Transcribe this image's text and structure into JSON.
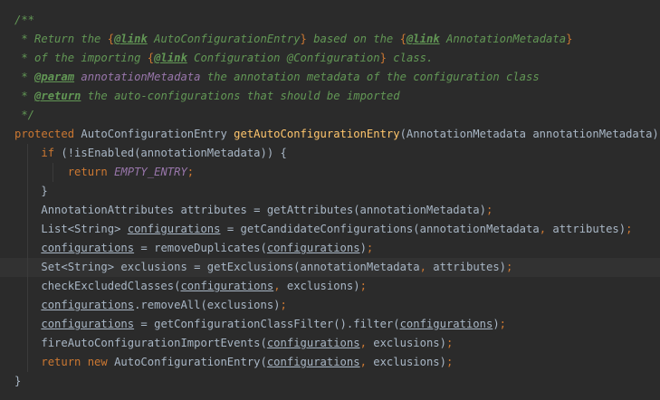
{
  "editor": {
    "language": "java",
    "theme_colors": {
      "background": "#2b2b2b",
      "current_line": "#323232",
      "comment": "#629755",
      "keyword": "#cc7832",
      "method": "#ffc66d",
      "constant": "#9876aa",
      "text": "#a9b7c6"
    },
    "lines": [
      {
        "indent": "",
        "segments": [
          {
            "t": "/**",
            "s": "c"
          }
        ]
      },
      {
        "indent": " ",
        "segments": [
          {
            "t": "* Return the ",
            "s": "c"
          },
          {
            "t": "{",
            "s": "br"
          },
          {
            "t": "@link",
            "s": "tag"
          },
          {
            "t": " AutoConfigurationEntry",
            "s": "lnk"
          },
          {
            "t": "}",
            "s": "br"
          },
          {
            "t": " based on the ",
            "s": "c"
          },
          {
            "t": "{",
            "s": "br"
          },
          {
            "t": "@link",
            "s": "tag"
          },
          {
            "t": " AnnotationMetadata",
            "s": "lnk"
          },
          {
            "t": "}",
            "s": "br"
          }
        ]
      },
      {
        "indent": " ",
        "segments": [
          {
            "t": "* of the importing ",
            "s": "c"
          },
          {
            "t": "{",
            "s": "br"
          },
          {
            "t": "@link",
            "s": "tag"
          },
          {
            "t": " Configuration ",
            "s": "lnk"
          },
          {
            "t": "@Configuration",
            "s": "lnk"
          },
          {
            "t": "}",
            "s": "br"
          },
          {
            "t": " class.",
            "s": "c"
          }
        ]
      },
      {
        "indent": " ",
        "segments": [
          {
            "t": "* ",
            "s": "c"
          },
          {
            "t": "@param",
            "s": "tag"
          },
          {
            "t": " annotationMetadata",
            "s": "cst"
          },
          {
            "t": " the annotation metadata of the configuration class",
            "s": "c"
          }
        ]
      },
      {
        "indent": " ",
        "segments": [
          {
            "t": "* ",
            "s": "c"
          },
          {
            "t": "@return",
            "s": "tag"
          },
          {
            "t": " the auto-configurations that should be imported",
            "s": "c"
          }
        ]
      },
      {
        "indent": " ",
        "segments": [
          {
            "t": "*/",
            "s": "c"
          }
        ]
      },
      {
        "indent": "",
        "segments": [
          {
            "t": "protected",
            "s": "k"
          },
          {
            "t": " AutoConfigurationEntry ",
            "s": ""
          },
          {
            "t": "getAutoConfigurationEntry",
            "s": "fn"
          },
          {
            "t": "(AnnotationMetadata annotationMetadata) {",
            "s": ""
          }
        ]
      },
      {
        "indent": "    ",
        "segments": [
          {
            "t": "if",
            "s": "k"
          },
          {
            "t": " (!isEnabled(annotationMetadata)) {",
            "s": ""
          }
        ]
      },
      {
        "indent": "        ",
        "segments": [
          {
            "t": "return",
            "s": "k"
          },
          {
            "t": " ",
            "s": ""
          },
          {
            "t": "EMPTY_ENTRY",
            "s": "cst"
          },
          {
            "t": ";",
            "s": "k"
          }
        ]
      },
      {
        "indent": "    ",
        "segments": [
          {
            "t": "}",
            "s": ""
          }
        ]
      },
      {
        "indent": "    ",
        "segments": [
          {
            "t": "AnnotationAttributes attributes = getAttributes(annotationMetadata)",
            "s": ""
          },
          {
            "t": ";",
            "s": "k"
          }
        ]
      },
      {
        "indent": "    ",
        "segments": [
          {
            "t": "List<String> ",
            "s": ""
          },
          {
            "t": "configurations",
            "s": "u"
          },
          {
            "t": " = getCandidateConfigurations(annotationMetadata",
            "s": ""
          },
          {
            "t": ",",
            "s": "k"
          },
          {
            "t": " attributes)",
            "s": ""
          },
          {
            "t": ";",
            "s": "k"
          }
        ]
      },
      {
        "indent": "    ",
        "segments": [
          {
            "t": "configurations",
            "s": "u"
          },
          {
            "t": " = removeDuplicates(",
            "s": ""
          },
          {
            "t": "configurations",
            "s": "u"
          },
          {
            "t": ")",
            "s": ""
          },
          {
            "t": ";",
            "s": "k"
          }
        ]
      },
      {
        "indent": "    ",
        "current": true,
        "segments": [
          {
            "t": "Set<String> exclusions = getExclusions(annotationMetadata",
            "s": ""
          },
          {
            "t": ",",
            "s": "k"
          },
          {
            "t": " attributes)",
            "s": ""
          },
          {
            "t": ";",
            "s": "k"
          }
        ]
      },
      {
        "indent": "    ",
        "segments": [
          {
            "t": "checkExcludedClasses(",
            "s": ""
          },
          {
            "t": "configurations",
            "s": "u"
          },
          {
            "t": ",",
            "s": "k"
          },
          {
            "t": " exclusions)",
            "s": ""
          },
          {
            "t": ";",
            "s": "k"
          }
        ]
      },
      {
        "indent": "    ",
        "segments": [
          {
            "t": "configurations",
            "s": "u"
          },
          {
            "t": ".removeAll(exclusions)",
            "s": ""
          },
          {
            "t": ";",
            "s": "k"
          }
        ]
      },
      {
        "indent": "    ",
        "segments": [
          {
            "t": "configurations",
            "s": "u"
          },
          {
            "t": " = getConfigurationClassFilter().filter(",
            "s": ""
          },
          {
            "t": "configurations",
            "s": "u"
          },
          {
            "t": ")",
            "s": ""
          },
          {
            "t": ";",
            "s": "k"
          }
        ]
      },
      {
        "indent": "    ",
        "segments": [
          {
            "t": "fireAutoConfigurationImportEvents(",
            "s": ""
          },
          {
            "t": "configurations",
            "s": "u"
          },
          {
            "t": ",",
            "s": "k"
          },
          {
            "t": " exclusions)",
            "s": ""
          },
          {
            "t": ";",
            "s": "k"
          }
        ]
      },
      {
        "indent": "    ",
        "segments": [
          {
            "t": "return new",
            "s": "k"
          },
          {
            "t": " AutoConfigurationEntry(",
            "s": ""
          },
          {
            "t": "configurations",
            "s": "u"
          },
          {
            "t": ",",
            "s": "k"
          },
          {
            "t": " exclusions)",
            "s": ""
          },
          {
            "t": ";",
            "s": "k"
          }
        ]
      },
      {
        "indent": "",
        "segments": [
          {
            "t": "}",
            "s": ""
          }
        ]
      }
    ]
  }
}
